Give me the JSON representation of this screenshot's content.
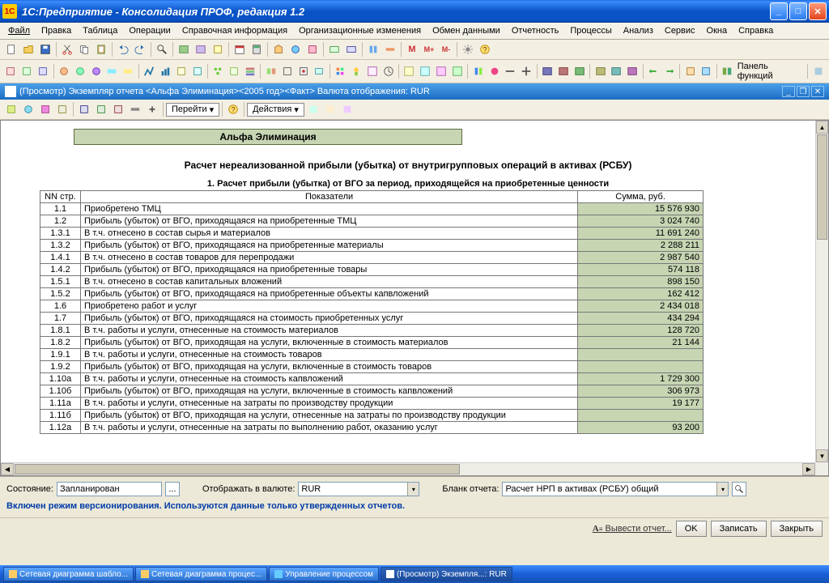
{
  "window": {
    "title": "1С:Предприятие - Консолидация ПРОФ, редакция 1.2"
  },
  "menu": [
    "Файл",
    "Правка",
    "Таблица",
    "Операции",
    "Справочная информация",
    "Организационные изменения",
    "Обмен данными",
    "Отчетность",
    "Процессы",
    "Анализ",
    "Сервис",
    "Окна",
    "Справка"
  ],
  "panel_functions_label": "Панель функций",
  "docbar": {
    "title": "(Просмотр) Экземпляр отчета <Альфа Элиминация><2005 год><Факт> Валюта отображения: RUR"
  },
  "doctool": {
    "goto": "Перейти",
    "actions": "Действия"
  },
  "report": {
    "banner": "Альфа Элиминация",
    "title": "Расчет нереализованной прибыли (убытка) от внутригрупповых операций в активах (РСБУ)",
    "section": "1. Расчет прибыли (убытка) от ВГО за период, приходящейся на приобретенные ценности",
    "headers": {
      "n": "NN стр.",
      "ind": "Показатели",
      "sum": "Сумма, руб."
    },
    "rows": [
      {
        "n": "1.1",
        "ind": "Приобретено ТМЦ",
        "sum": "15 576 930"
      },
      {
        "n": "1.2",
        "ind": "Прибыль (убыток) от ВГО, приходящаяся на приобретенные ТМЦ",
        "sum": "3 024 740"
      },
      {
        "n": "1.3.1",
        "ind": "В т.ч. отнесено в состав сырья и материалов",
        "sum": "11 691 240"
      },
      {
        "n": "1.3.2",
        "ind": "Прибыль (убыток) от ВГО, приходящаяся на приобретенные материалы",
        "sum": "2 288 211"
      },
      {
        "n": "1.4.1",
        "ind": "В т.ч. отнесено в состав товаров для перепродажи",
        "sum": "2 987 540"
      },
      {
        "n": "1.4.2",
        "ind": "Прибыль (убыток) от ВГО, приходящаяся на приобретенные товары",
        "sum": "574 118"
      },
      {
        "n": "1.5.1",
        "ind": "В т.ч. отнесено в состав капитальных вложений",
        "sum": "898 150"
      },
      {
        "n": "1.5.2",
        "ind": "Прибыль (убыток) от ВГО, приходящаяся на приобретенные объекты капвложений",
        "sum": "162 412"
      },
      {
        "n": "1.6",
        "ind": "Приобретено работ и услуг",
        "sum": "2 434 018"
      },
      {
        "n": "1.7",
        "ind": "Прибыль (убыток) от ВГО, приходящаяся на стоимость приобретенных услуг",
        "sum": "434 294"
      },
      {
        "n": "1.8.1",
        "ind": "В т.ч. работы и услуги, отнесенные на стоимость материалов",
        "sum": "128 720"
      },
      {
        "n": "1.8.2",
        "ind": "Прибыль (убыток) от ВГО, приходящая на услуги, включенные в стоимость материалов",
        "sum": "21 144"
      },
      {
        "n": "1.9.1",
        "ind": "В т.ч. работы и услуги, отнесенные на стоимость товаров",
        "sum": ""
      },
      {
        "n": "1.9.2",
        "ind": "Прибыль (убыток) от ВГО, приходящая на услуги, включенные в стоимость товаров",
        "sum": ""
      },
      {
        "n": "1.10а",
        "ind": "В т.ч. работы и услуги, отнесенные на стоимость капвложений",
        "sum": "1 729 300"
      },
      {
        "n": "1.10б",
        "ind": "Прибыль (убыток) от ВГО, приходящая на услуги, включенные в стоимость капвложений",
        "sum": "306 973"
      },
      {
        "n": "1.11а",
        "ind": "В т.ч. работы и услуги, отнесенные на затраты по производству продукции",
        "sum": "19 177"
      },
      {
        "n": "1.11б",
        "ind": "Прибыль (убыток) от ВГО, приходящая на услуги, отнесенные на затраты по производству продукции",
        "sum": ""
      },
      {
        "n": "1.12а",
        "ind": "В т.ч. работы и услуги, отнесенные на затраты по выполнению работ, оказанию услуг",
        "sum": "93 200"
      }
    ]
  },
  "bottom": {
    "state_label": "Состояние:",
    "state_value": "Запланирован",
    "currency_label": "Отображать в валюте:",
    "currency_value": "RUR",
    "blank_label": "Бланк отчета:",
    "blank_value": "Расчет НРП в активах (РСБУ) общий",
    "note": "Включен режим версионирования. Используются данные только утвержденных отчетов."
  },
  "actions": {
    "print": "Вывести отчет...",
    "ok": "OK",
    "save": "Записать",
    "close": "Закрыть"
  },
  "tasks": [
    "Сетевая диаграмма шабло...",
    "Сетевая диаграмма процес...",
    "Управление процессом",
    "(Просмотр) Экземпля...: RUR"
  ]
}
